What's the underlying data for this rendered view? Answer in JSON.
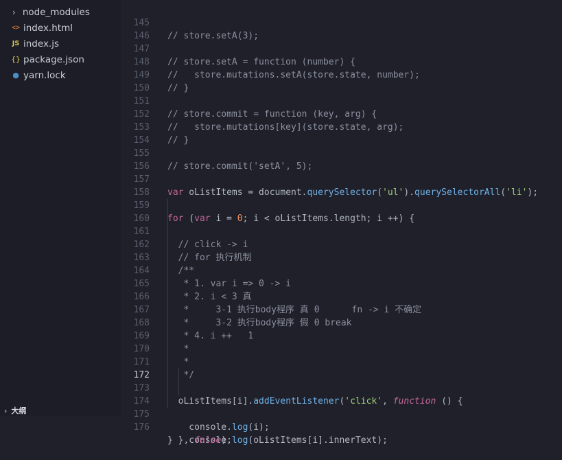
{
  "sidebar": {
    "items": [
      {
        "label": "node_modules",
        "icon": "chevron-right-icon"
      },
      {
        "label": "index.html",
        "icon": "html-file-icon"
      },
      {
        "label": "index.js",
        "icon": "js-file-icon"
      },
      {
        "label": "package.json",
        "icon": "json-file-icon"
      },
      {
        "label": "yarn.lock",
        "icon": "yarn-file-icon"
      }
    ],
    "outline_label": "大纲"
  },
  "editor": {
    "active_line": "172",
    "lines": [
      {
        "num": "145",
        "text": "// store.setA(3);"
      },
      {
        "num": "146",
        "text": ""
      },
      {
        "num": "147",
        "text": "// store.setA = function (number) {"
      },
      {
        "num": "148",
        "text": "//   store.mutations.setA(store.state, number);"
      },
      {
        "num": "149",
        "text": "// }"
      },
      {
        "num": "150",
        "text": ""
      },
      {
        "num": "151",
        "text": "// store.commit = function (key, arg) {"
      },
      {
        "num": "152",
        "text": "//   store.mutations[key](store.state, arg);"
      },
      {
        "num": "153",
        "text": "// }"
      },
      {
        "num": "154",
        "text": ""
      },
      {
        "num": "155",
        "text": "// store.commit('setA', 5);"
      },
      {
        "num": "156",
        "text": ""
      },
      {
        "num": "157",
        "text": "var oListItems = document.querySelector('ul').querySelectorAll('li');"
      },
      {
        "num": "158",
        "text": ""
      },
      {
        "num": "159",
        "text": "for (var i = 0; i < oListItems.length; i ++) {"
      },
      {
        "num": "160",
        "text": "  // click -> i"
      },
      {
        "num": "161",
        "text": "  // for 执行机制"
      },
      {
        "num": "162",
        "text": "  /**"
      },
      {
        "num": "163",
        "text": "   * 1. var i => 0 -> i"
      },
      {
        "num": "164",
        "text": "   * 2. i < 3 真"
      },
      {
        "num": "165",
        "text": "   *     3-1 执行body程序 真 0      fn -> i 不确定"
      },
      {
        "num": "166",
        "text": "   *     3-2 执行body程序 假 0 break"
      },
      {
        "num": "167",
        "text": "   * 4. i ++   1"
      },
      {
        "num": "168",
        "text": "   *"
      },
      {
        "num": "169",
        "text": "   *"
      },
      {
        "num": "170",
        "text": "   */"
      },
      {
        "num": "171",
        "text": ""
      },
      {
        "num": "172",
        "text": "  oListItems[i].addEventListener('click', function () {"
      },
      {
        "num": "173",
        "text": "    console.log(i);"
      },
      {
        "num": "174",
        "text": "    console.log(oListItems[i].innerText);"
      },
      {
        "num": "175",
        "text": "  }, false);"
      },
      {
        "num": "176",
        "text": "}"
      }
    ]
  },
  "colors": {
    "background": "#1f2029",
    "comment": "#8b90a0",
    "keyword": "#c5689b",
    "function": "#6fb1e8",
    "string": "#9fcf7a",
    "number": "#f08f5a"
  }
}
